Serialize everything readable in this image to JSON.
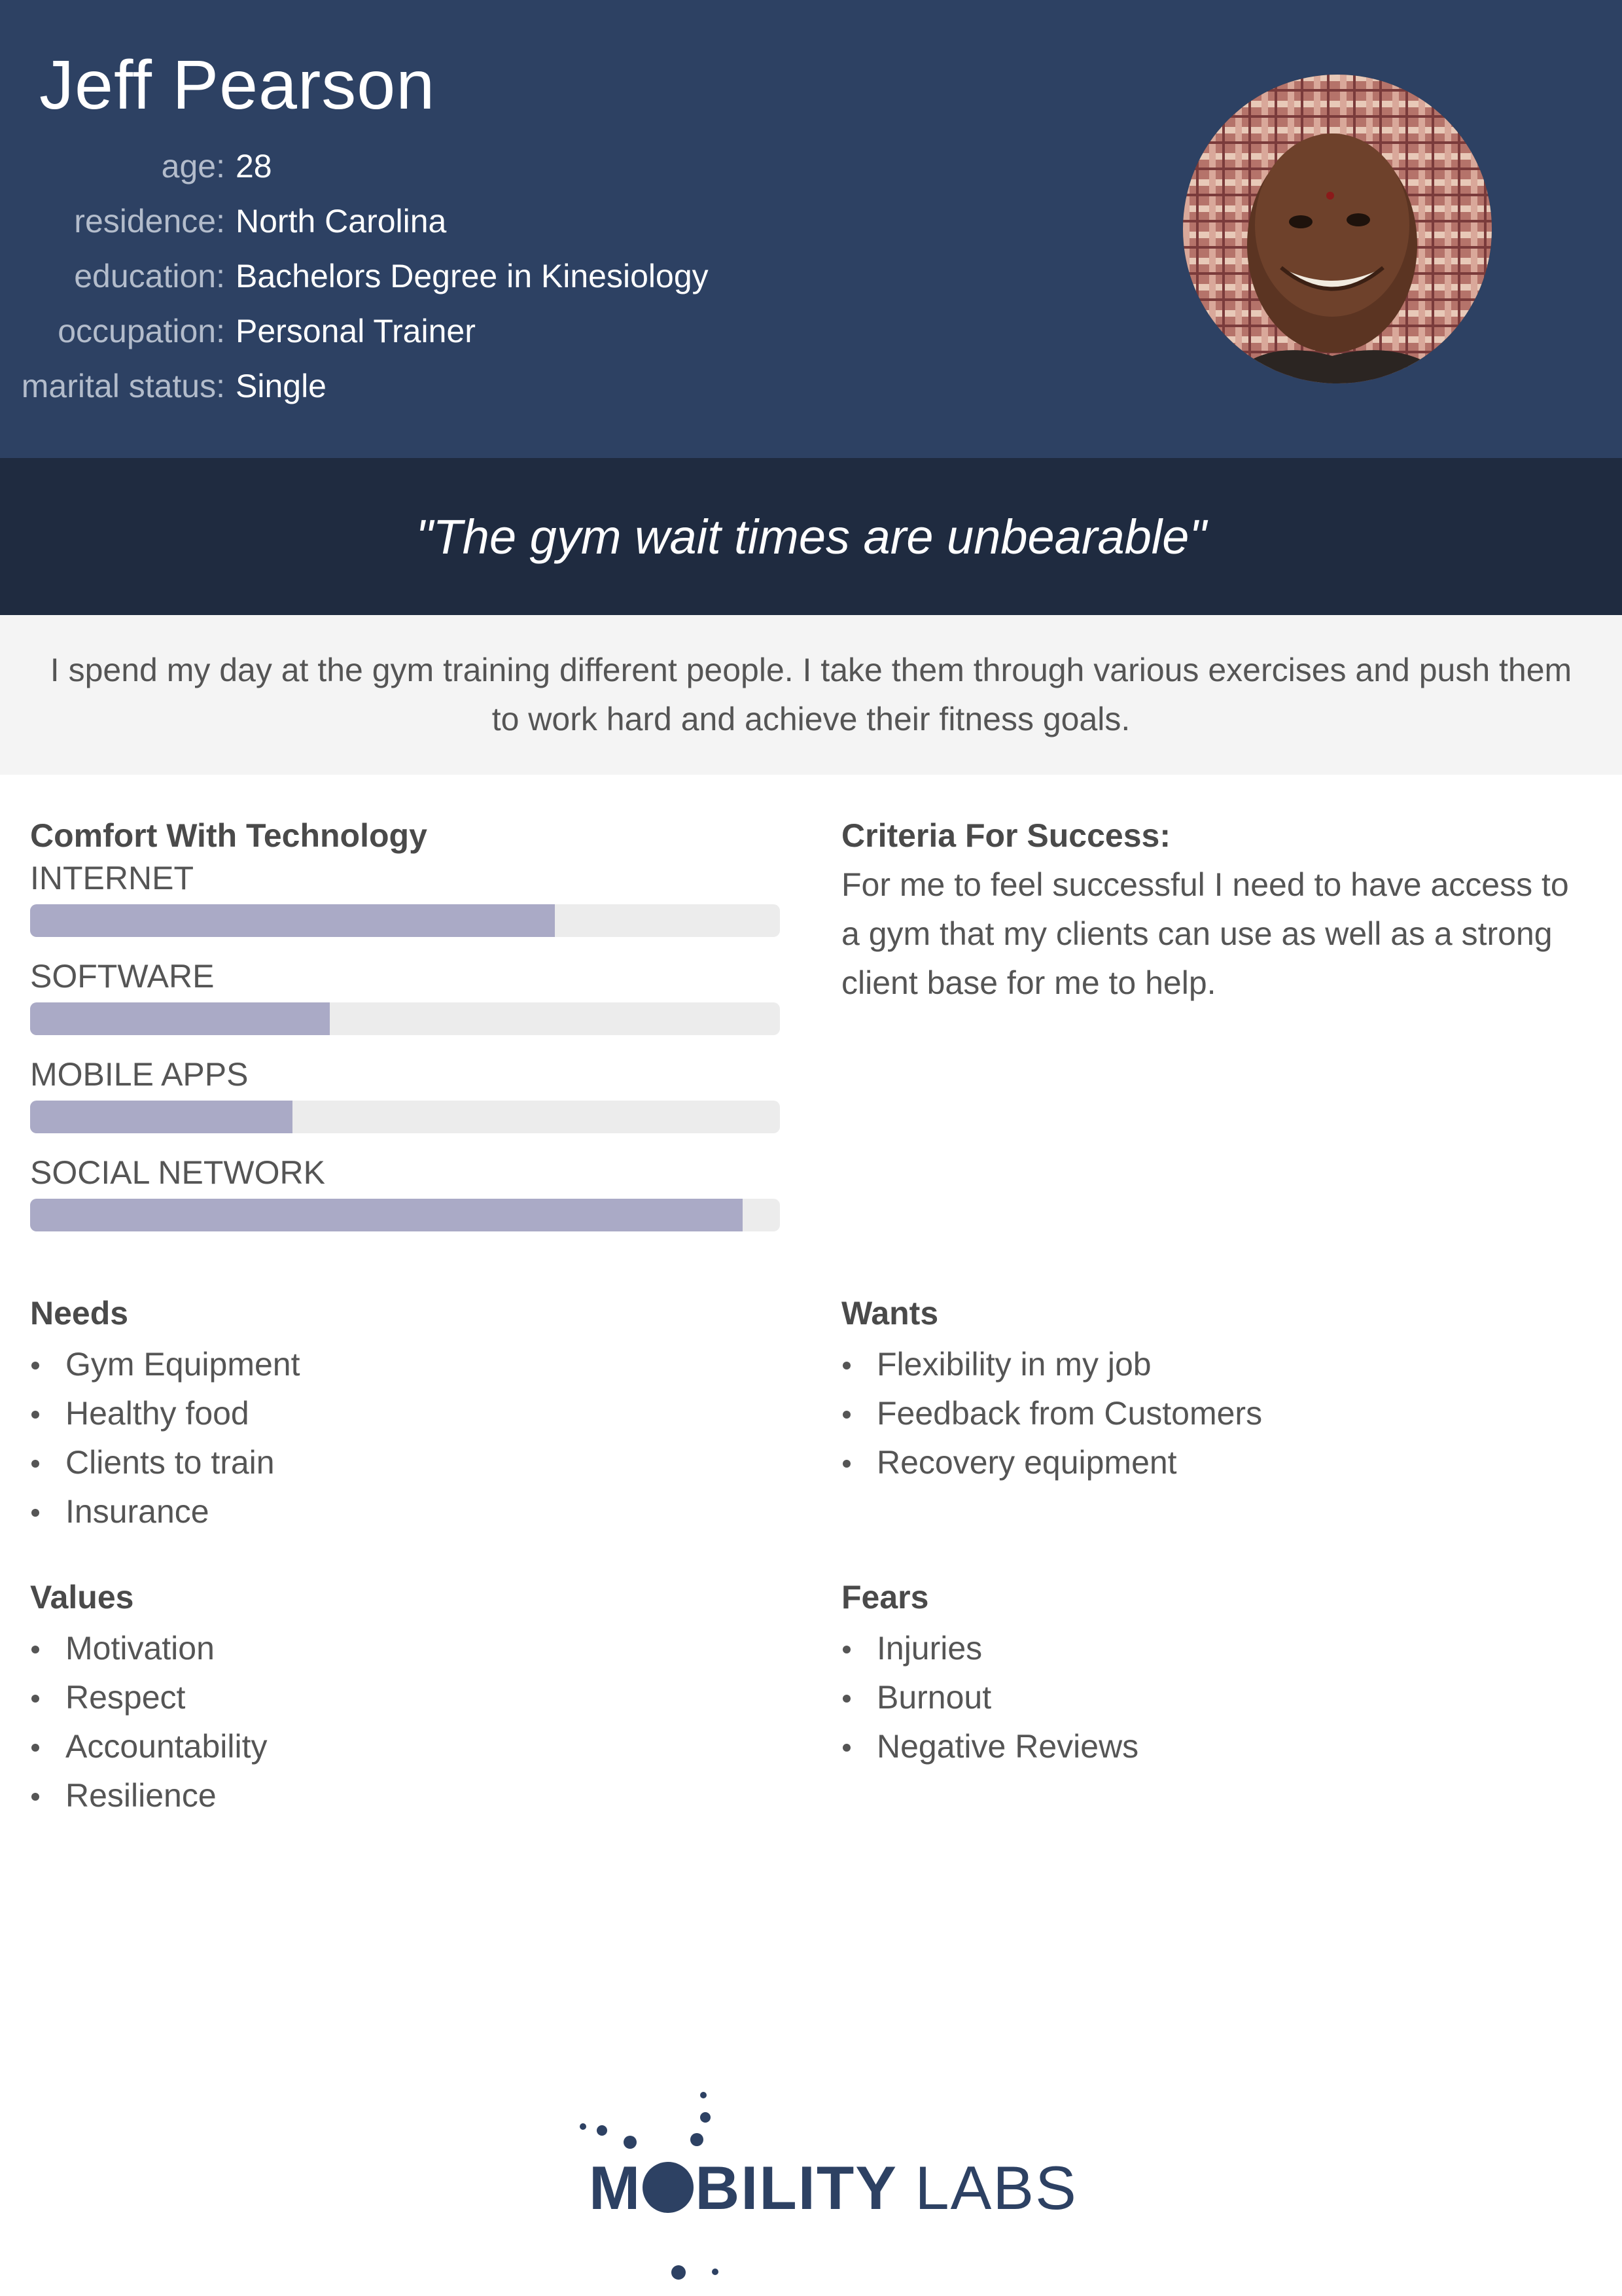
{
  "persona": {
    "name": "Jeff Pearson",
    "details": [
      {
        "label": "age:",
        "value": "28"
      },
      {
        "label": "residence:",
        "value": "North Carolina"
      },
      {
        "label": "education:",
        "value": "Bachelors Degree in Kinesiology"
      },
      {
        "label": "occupation:",
        "value": "Personal Trainer"
      },
      {
        "label": "marital status:",
        "value": "Single"
      }
    ]
  },
  "quote": "\"The gym wait times are unbearable\"",
  "intro": "I spend my day at the gym training different people. I take them through various exercises and push them to work hard and achieve their fitness goals.",
  "tech": {
    "title": "Comfort With Technology",
    "items": [
      {
        "label": "INTERNET",
        "level": 0.7
      },
      {
        "label": "SOFTWARE",
        "level": 0.4
      },
      {
        "label": "MOBILE APPS",
        "level": 0.35
      },
      {
        "label": "SOCIAL NETWORK",
        "level": 0.95
      }
    ]
  },
  "criteria": {
    "title": "Criteria For Success:",
    "text": "For me to feel successful I need to have access to a gym that my clients can use as well as a strong client base for me to help."
  },
  "needs": {
    "title": "Needs",
    "items": [
      "Gym Equipment",
      "Healthy food",
      "Clients to train",
      "Insurance"
    ]
  },
  "wants": {
    "title": "Wants",
    "items": [
      "Flexibility in my job",
      "Feedback from Customers",
      "Recovery equipment"
    ]
  },
  "values": {
    "title": "Values",
    "items": [
      "Motivation",
      "Respect",
      "Accountability",
      "Resilience"
    ]
  },
  "fears": {
    "title": "Fears",
    "items": [
      "Injuries",
      "Burnout",
      "Negative Reviews"
    ]
  },
  "logo": {
    "part1": "M",
    "part2": "BILITY",
    "part3": "LABS"
  },
  "colors": {
    "header": "#2d4163",
    "quote_band": "#1f2b40",
    "intro_bg": "#f4f4f4",
    "bar_fill": "#aaaac6",
    "bar_track": "#ececec"
  }
}
